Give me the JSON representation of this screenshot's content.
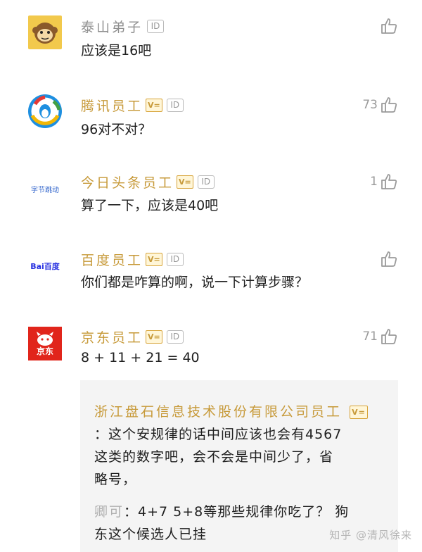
{
  "comments": [
    {
      "user": "泰山弟子",
      "name_style": "gray",
      "verified": false,
      "id_badge": "ID",
      "text": "应该是16吧",
      "likes": "",
      "avatar_icon": "monkey-face-icon"
    },
    {
      "user": "腾讯员工",
      "name_style": "gold",
      "verified": true,
      "id_badge": "ID",
      "text": "96对不对？",
      "likes": "73",
      "avatar_icon": "tencent-logo"
    },
    {
      "user": "今日头条员工",
      "name_style": "gold",
      "verified": true,
      "id_badge": "ID",
      "text": "算了一下，应该是40吧",
      "likes": "1",
      "avatar_icon": "bytedance-logo",
      "avatar_text": "字节跳动"
    },
    {
      "user": "百度员工",
      "name_style": "gold",
      "verified": true,
      "id_badge": "ID",
      "text": "你们都是咋算的啊，说一下计算步骤？",
      "likes": "",
      "avatar_icon": "baidu-logo",
      "avatar_text": "Bai百度"
    },
    {
      "user": "京东员工",
      "name_style": "gold",
      "verified": true,
      "id_badge": "ID",
      "text": "8 + 11 + 21 = 40",
      "likes": "71",
      "avatar_icon": "jd-logo",
      "avatar_text": "京东"
    }
  ],
  "reply": {
    "org": "浙江盘石信息技术股份有限公司员工",
    "lines": [
      "：这个安规律的话中间应该也会有4567",
      "这类的数字吧，会不会是中间少了，省",
      "略号，"
    ],
    "user": "卿可",
    "reply_text": "：4+7  5+8等那些规律你吃了？ 狗",
    "reply_text2": "东这个候选人已挂"
  },
  "verified_label": "V=",
  "watermark": "知乎 @清风徐来",
  "colors": {
    "gold": "#c79a3a",
    "gray": "#8f8f8f",
    "tencent_blue": "#1e8fe0",
    "jd_red": "#e1251b"
  }
}
